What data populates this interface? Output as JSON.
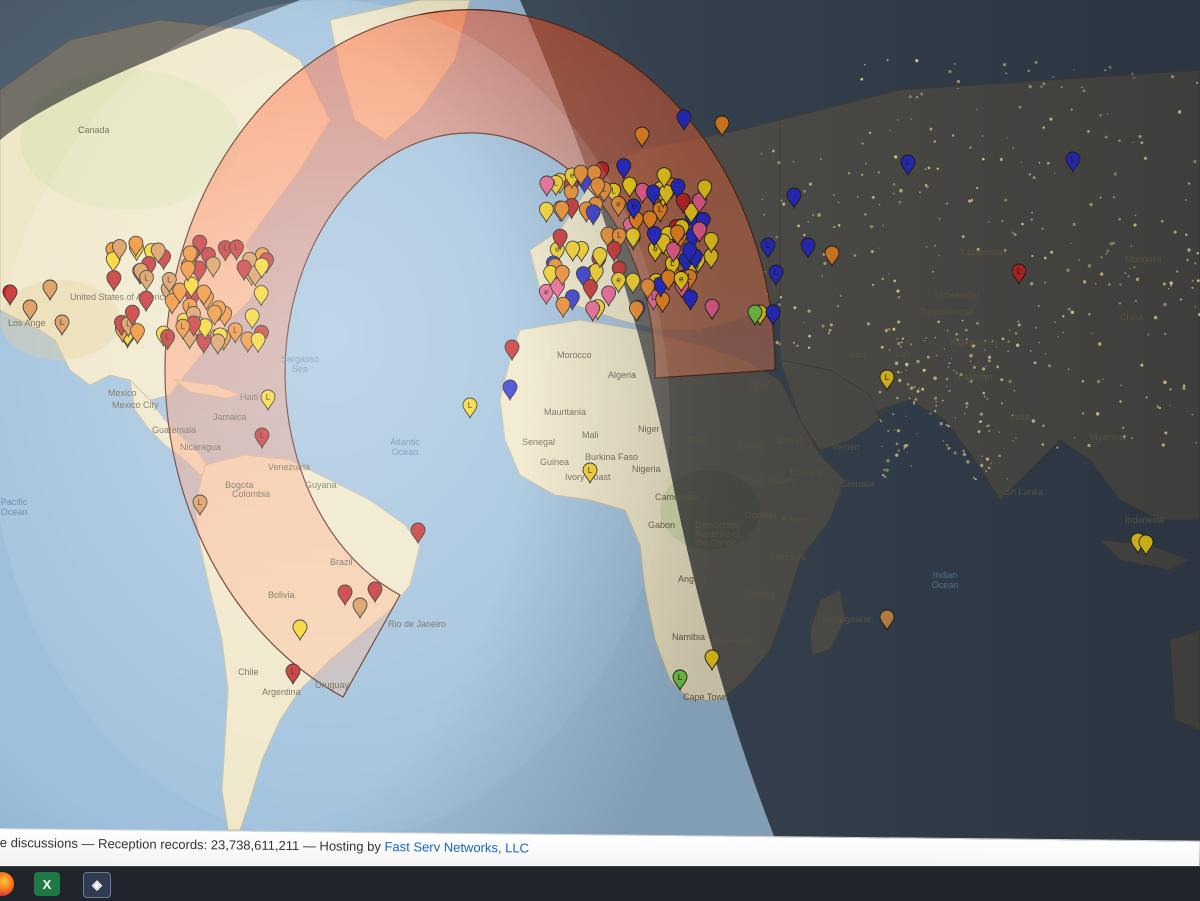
{
  "map": {
    "ocean_labels": {
      "atlantic": "Atlantic\nOcean",
      "sargasso": "Sargasso\nSea",
      "pacific": "Pacific\nOcean",
      "indian": "Indian\nOcean"
    },
    "country_labels": [
      {
        "key": "canada",
        "text": "Canada"
      },
      {
        "key": "mexico",
        "text": "Mexico"
      },
      {
        "key": "mexico_city",
        "text": "Mexico City"
      },
      {
        "key": "guatemala",
        "text": "Guatemala"
      },
      {
        "key": "nicaragua",
        "text": "Nicaragua"
      },
      {
        "key": "haiti",
        "text": "Haiti"
      },
      {
        "key": "jamaica",
        "text": "Jamaica"
      },
      {
        "key": "venezuela",
        "text": "Venezuela"
      },
      {
        "key": "bogota",
        "text": "Bogota"
      },
      {
        "key": "colombia",
        "text": "Colombia"
      },
      {
        "key": "guyana",
        "text": "Guyana"
      },
      {
        "key": "brazil",
        "text": "Brazil"
      },
      {
        "key": "bolivia",
        "text": "Bolivia"
      },
      {
        "key": "chile",
        "text": "Chile"
      },
      {
        "key": "argentina",
        "text": "Argentina"
      },
      {
        "key": "uruguay",
        "text": "Uruguay"
      },
      {
        "key": "rio",
        "text": "Rio de Janeiro"
      },
      {
        "key": "morocco",
        "text": "Morocco"
      },
      {
        "key": "algeria",
        "text": "Algeria"
      },
      {
        "key": "libya",
        "text": "Libya"
      },
      {
        "key": "egypt",
        "text": "Egypt"
      },
      {
        "key": "mauritania",
        "text": "Mauritania"
      },
      {
        "key": "mali",
        "text": "Mali"
      },
      {
        "key": "niger",
        "text": "Niger"
      },
      {
        "key": "chad",
        "text": "Chad"
      },
      {
        "key": "sudan",
        "text": "Sudan"
      },
      {
        "key": "senegal",
        "text": "Senegal"
      },
      {
        "key": "guinea",
        "text": "Guinea"
      },
      {
        "key": "burkina",
        "text": "Burkina Faso"
      },
      {
        "key": "nigeria",
        "text": "Nigeria"
      },
      {
        "key": "ivory",
        "text": "Ivory Coast"
      },
      {
        "key": "cameroon",
        "text": "Cameroon"
      },
      {
        "key": "gabon",
        "text": "Gabon"
      },
      {
        "key": "south_sudan",
        "text": "South Sudan"
      },
      {
        "key": "ethiopia",
        "text": "Ethiopia"
      },
      {
        "key": "uganda",
        "text": "Uganda"
      },
      {
        "key": "kenya",
        "text": "Kenya"
      },
      {
        "key": "drc",
        "text": "Democratic\nRepublic of\nthe Congo"
      },
      {
        "key": "tanzania",
        "text": "Tanzania"
      },
      {
        "key": "angola",
        "text": "Angola"
      },
      {
        "key": "zambia",
        "text": "Zambia"
      },
      {
        "key": "namibia",
        "text": "Namibia"
      },
      {
        "key": "botswana",
        "text": "Botswana"
      },
      {
        "key": "madagascar",
        "text": "Madagascar"
      },
      {
        "key": "cape_town",
        "text": "Cape Town"
      },
      {
        "key": "eritrea",
        "text": "Eritrea"
      },
      {
        "key": "somalia",
        "text": "Somalia"
      },
      {
        "key": "yemen",
        "text": "Yemen"
      },
      {
        "key": "kazakhstan",
        "text": "Kazakhstan"
      },
      {
        "key": "mongolia",
        "text": "Mongolia"
      },
      {
        "key": "uzbekistan",
        "text": "Uzbekistan"
      },
      {
        "key": "turkmenistan",
        "text": "Turkmenistan"
      },
      {
        "key": "afghanistan",
        "text": "Afghanistan"
      },
      {
        "key": "pakistan",
        "text": "Pakistan"
      },
      {
        "key": "india",
        "text": "India"
      },
      {
        "key": "sri_lanka",
        "text": "Sri Lanka"
      },
      {
        "key": "china",
        "text": "China"
      },
      {
        "key": "los_angeles",
        "text": "Los Ange"
      },
      {
        "key": "united_states",
        "text": "United States of America"
      },
      {
        "key": "iran",
        "text": "Iran"
      },
      {
        "key": "iraq",
        "text": "Iraq"
      },
      {
        "key": "myanmar",
        "text": "Myanmar"
      },
      {
        "key": "indonesia",
        "text": "Indonesia"
      }
    ],
    "marker_colors": {
      "orange": "#f08a24",
      "yellow": "#f7d21e",
      "red": "#c62828",
      "blue": "#2b2fd0",
      "pink": "#f06292",
      "green": "#7bd24a",
      "tan": "#d99552"
    }
  },
  "footer": {
    "prefix": "e discussions — Reception records: 23,738,611,211 — Hosting by ",
    "link": "Fast Serv Networks, LLC"
  },
  "taskbar": {
    "apps": [
      {
        "name": "Firefox",
        "icon": "firefox-icon"
      },
      {
        "name": "Excel",
        "icon": "excel-icon",
        "glyph": "X"
      },
      {
        "name": "Map client",
        "icon": "app-window-icon",
        "glyph": "◈"
      }
    ]
  }
}
